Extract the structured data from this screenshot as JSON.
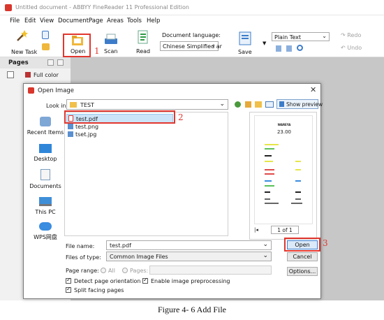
{
  "window": {
    "title": "Untitled document - ABBYY FineReader 11 Professional Edition"
  },
  "menu": [
    "File",
    "Edit",
    "View",
    "Document",
    "Page",
    "Areas",
    "Tools",
    "Help"
  ],
  "toolbar": {
    "new_task": "New Task",
    "open": "Open",
    "scan": "Scan",
    "read": "Read",
    "document_language_label": "Document language:",
    "document_language_value": "Chinese Simplified ar",
    "save": "Save",
    "save_format": "Plain Text",
    "redo": "Redo",
    "undo": "Undo"
  },
  "pages_panel": {
    "title": "Pages",
    "color_mode": "Full color"
  },
  "annotations": {
    "n1": "1",
    "n2": "2",
    "n3": "3"
  },
  "dialog": {
    "title": "Open Image",
    "look_in_label": "Look in:",
    "look_in_value": "TEST",
    "show_preview": "Show preview",
    "places": [
      "Recent Items",
      "Desktop",
      "Documents",
      "This PC",
      "WPS网盘"
    ],
    "files": [
      "test.pdf",
      "test.png",
      "tset.jpg"
    ],
    "preview": {
      "brand": "WAREYA",
      "amount": "23.00",
      "page_indicator": "1 of 1"
    },
    "file_name_label": "File name:",
    "file_name_value": "test.pdf",
    "files_of_type_label": "Files of type:",
    "files_of_type_value": "Common Image Files",
    "page_range_label": "Page range:",
    "page_range_all": "All",
    "page_range_pages": "Pages:",
    "open_button": "Open",
    "cancel_button": "Cancel",
    "options_button": "Options...",
    "detect_orientation": "Detect page orientation",
    "enable_preprocessing": "Enable image preprocessing",
    "split_facing": "Split facing pages"
  },
  "caption": "Figure 4- 6 Add File",
  "colors": {
    "accent_red": "#e2362e",
    "selection_blue": "#cce4f7",
    "brand": "#d9362c"
  }
}
